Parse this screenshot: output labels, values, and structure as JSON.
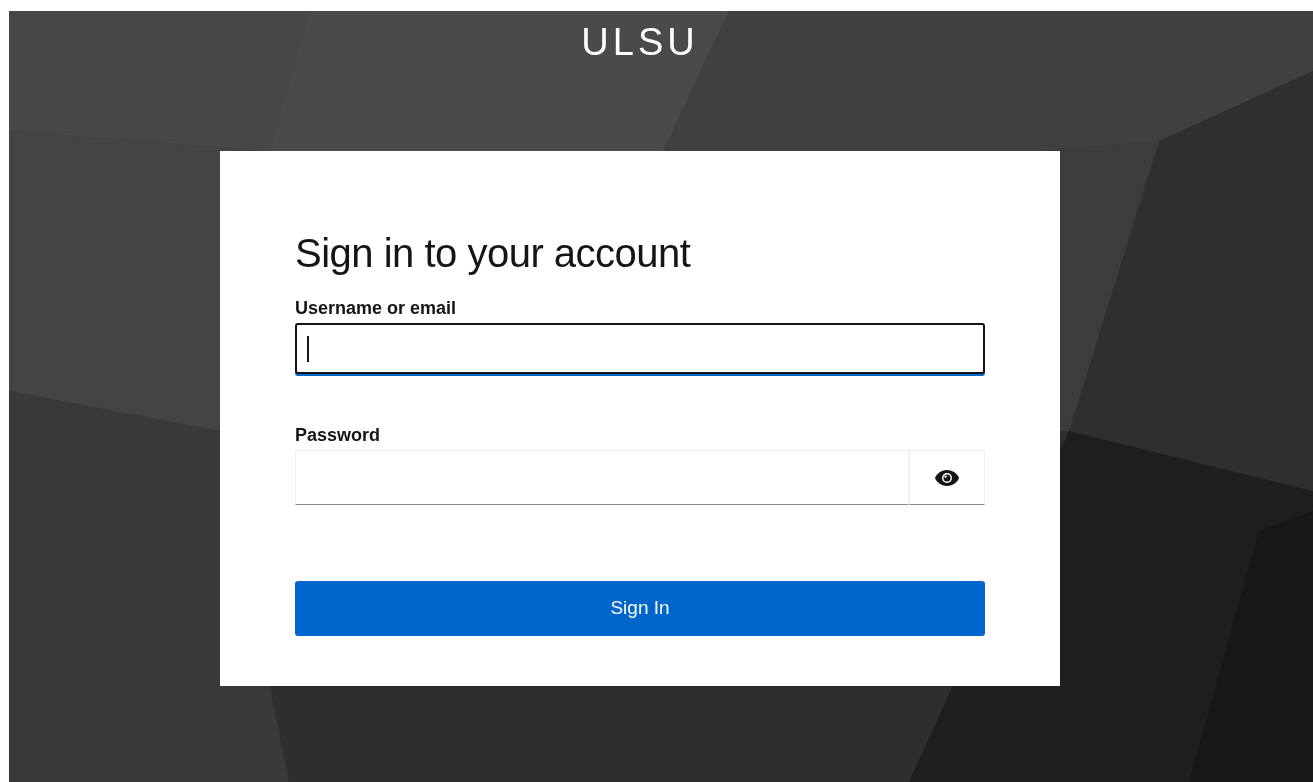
{
  "brand": "ULSU",
  "heading": "Sign in to your account",
  "fields": [
    {
      "kind": "text",
      "label": "Username or email",
      "focused": true
    },
    {
      "kind": "password",
      "label": "Password",
      "focused": false
    }
  ],
  "submit": {
    "label": "Sign In"
  }
}
